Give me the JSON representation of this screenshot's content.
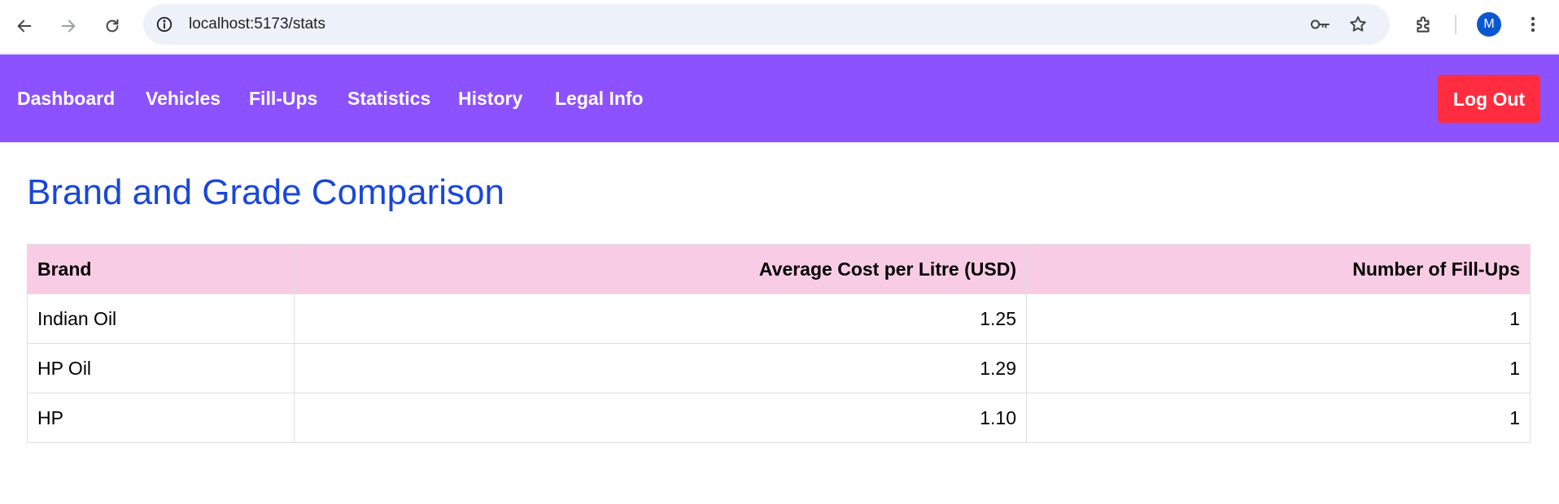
{
  "browser": {
    "url": "localhost:5173/stats",
    "avatar_initial": "M",
    "icons": [
      "back-icon",
      "forward-icon",
      "reload-icon",
      "info-icon",
      "key-icon",
      "star-icon",
      "extensions-icon",
      "more-menu-icon"
    ]
  },
  "nav": {
    "links": [
      "Dashboard",
      "Vehicles",
      "Fill-Ups",
      "Statistics",
      "History",
      "Legal Info"
    ],
    "logout_label": "Log Out",
    "background_color": "#8c52ff",
    "logout_color": "#ff2d3f"
  },
  "page": {
    "title": "Brand and Grade Comparison",
    "title_color": "#1a47d9"
  },
  "table": {
    "header_color": "#f9cce6",
    "columns": [
      "Brand",
      "Average Cost per Litre (USD)",
      "Number of Fill-Ups"
    ],
    "rows": [
      [
        "Indian Oil",
        "1.25",
        "1"
      ],
      [
        "HP Oil",
        "1.29",
        "1"
      ],
      [
        "HP",
        "1.10",
        "1"
      ]
    ]
  }
}
